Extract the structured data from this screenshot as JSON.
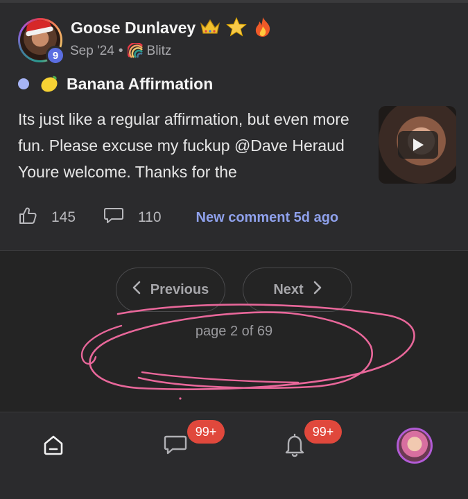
{
  "post": {
    "author": "Goose Dunlavey",
    "author_emoji": [
      "crown-emoji",
      "star-emoji",
      "fire-emoji"
    ],
    "level": "9",
    "date": "Sep '24",
    "separator": "•",
    "community": "Blitz",
    "title": "Banana Affirmation",
    "body": "Its just like a regular affirmation, but even more fun. Please excuse my fuckup @Dave Heraud Youre welcome. Thanks for the",
    "likes": "145",
    "comments": "110",
    "new_comment": "New comment 5d ago",
    "thumbnail_icon": "play-icon"
  },
  "pagination": {
    "previous_label": "Previous",
    "next_label": "Next",
    "page_text": "page 2 of 69"
  },
  "bottom_nav": {
    "items": [
      {
        "icon": "home-icon"
      },
      {
        "icon": "chat-icon",
        "badge": "99+"
      },
      {
        "icon": "bell-icon",
        "badge": "99+"
      },
      {
        "icon": "profile-avatar"
      }
    ]
  },
  "colors": {
    "background": "#242424",
    "card": "#2b2b2d",
    "accent_link": "#8fa1ec",
    "badge": "#e0483c",
    "level_badge": "#5b6ee1",
    "scribble": "#e8679a"
  }
}
